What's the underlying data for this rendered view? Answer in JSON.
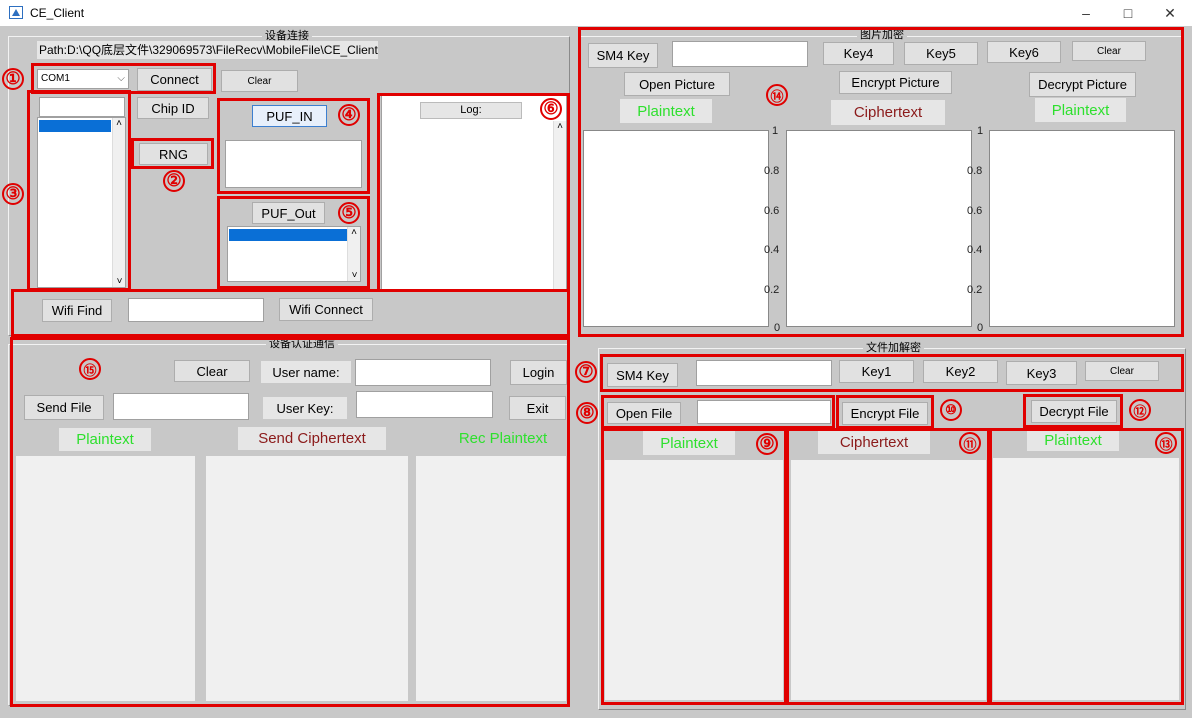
{
  "window": {
    "title": "CE_Client",
    "minimize": "–",
    "maximize": "□",
    "close": "✕"
  },
  "device_panel": {
    "title": "设备连接",
    "path": "Path:D:\\QQ底层文件\\329069573\\FileRecv\\MobileFile\\CE_Client",
    "com_value": "COM1",
    "connect": "Connect",
    "clear": "Clear",
    "chip_id": "Chip ID",
    "rng": "RNG",
    "puf_in": "PUF_IN",
    "puf_out": "PUF_Out",
    "log": "Log:",
    "wifi_find": "Wifi Find",
    "wifi_connect": "Wifi Connect"
  },
  "auth_panel": {
    "title": "设备认证通信",
    "clear": "Clear",
    "username_label": "User name:",
    "login": "Login",
    "send_file": "Send File",
    "userkey_label": "User Key:",
    "exit": "Exit",
    "plaintext": "Plaintext",
    "send_ciphertext": "Send Ciphertext",
    "rec_plaintext": "Rec Plaintext"
  },
  "image_panel": {
    "title": "图片加密",
    "sm4_key": "SM4 Key",
    "key4": "Key4",
    "key5": "Key5",
    "key6": "Key6",
    "clear": "Clear",
    "open_picture": "Open Picture",
    "encrypt_picture": "Encrypt  Picture",
    "decrypt_picture": "Decrypt Picture",
    "plaintext1": "Plaintext",
    "ciphertext": "Ciphertext",
    "plaintext2": "Plaintext",
    "y_ticks": [
      "1",
      "0.8",
      "0.6",
      "0.4",
      "0.2",
      "0"
    ]
  },
  "file_panel": {
    "title": "文件加解密",
    "sm4_key": "SM4 Key",
    "key1": "Key1",
    "key2": "Key2",
    "key3": "Key3",
    "clear": "Clear",
    "open_file": "Open File",
    "encrypt_file": "Encrypt File",
    "decrypt_file": "Decrypt File",
    "plaintext1": "Plaintext",
    "ciphertext": "Ciphertext",
    "plaintext2": "Plaintext"
  },
  "annotations": {
    "n1": "①",
    "n2": "②",
    "n3": "③",
    "n4": "④",
    "n5": "⑤",
    "n6": "⑥",
    "n7": "⑦",
    "n8": "⑧",
    "n9": "⑨",
    "n10": "⑩",
    "n11": "⑪",
    "n12": "⑫",
    "n13": "⑬",
    "n14": "⑭",
    "n15": "⑮"
  },
  "colors": {
    "annotation_red": "#e00000",
    "plaintext_green": "#2ee02e",
    "ciphertext_maroon": "#8b1a1a"
  }
}
